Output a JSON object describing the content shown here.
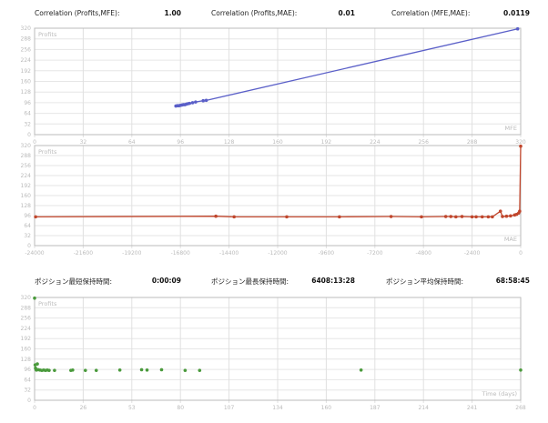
{
  "header1": [
    {
      "label": "Correlation (Profits,MFE):",
      "value": "1.00"
    },
    {
      "label": "Correlation (Profits,MAE):",
      "value": "0.01"
    },
    {
      "label": "Correlation (MFE,MAE):",
      "value": "0.0119"
    }
  ],
  "header2": [
    {
      "label": "ポジション最短保持時間:",
      "value": "0:00:09"
    },
    {
      "label": "ポジション最長保持時間:",
      "value": "6408:13:28"
    },
    {
      "label": "ポジション平均保持時間:",
      "value": "68:58:45"
    }
  ],
  "chart_data": [
    {
      "type": "scatter",
      "ylabel": "Profits",
      "xlabel": "MFE",
      "color": "#5a5fc8",
      "line": true,
      "xlim": [
        0,
        320
      ],
      "ylim": [
        0,
        320
      ],
      "xticks": [
        "0",
        "32",
        "64",
        "96",
        "128",
        "160",
        "192",
        "224",
        "256",
        "288",
        "320"
      ],
      "yticks": [
        "0",
        "32",
        "64",
        "96",
        "128",
        "160",
        "192",
        "224",
        "256",
        "288",
        "320"
      ],
      "points": [
        [
          93,
          86
        ],
        [
          94,
          87
        ],
        [
          95,
          87
        ],
        [
          96,
          88
        ],
        [
          97,
          89
        ],
        [
          98,
          90
        ],
        [
          99,
          90
        ],
        [
          100,
          92
        ],
        [
          101,
          93
        ],
        [
          102,
          94
        ],
        [
          104,
          96
        ],
        [
          106,
          98
        ],
        [
          111,
          102
        ],
        [
          113,
          103
        ],
        [
          318,
          318
        ]
      ]
    },
    {
      "type": "scatter",
      "ylabel": "Profits",
      "xlabel": "MAE",
      "color": "#c0462c",
      "line": true,
      "xlim": [
        -24000,
        0
      ],
      "ylim": [
        0,
        320
      ],
      "xticks": [
        "-24000",
        "-21600",
        "-19200",
        "-16800",
        "-14400",
        "-12000",
        "-9600",
        "-7200",
        "-4800",
        "-2400",
        "0"
      ],
      "yticks": [
        "0",
        "32",
        "64",
        "96",
        "128",
        "160",
        "192",
        "224",
        "256",
        "288",
        "320"
      ],
      "points": [
        [
          -23950,
          92
        ],
        [
          -15050,
          94
        ],
        [
          -14150,
          92
        ],
        [
          -11550,
          92
        ],
        [
          -8950,
          92
        ],
        [
          -6400,
          93
        ],
        [
          -4900,
          92
        ],
        [
          -3700,
          93
        ],
        [
          -3450,
          93
        ],
        [
          -3200,
          92
        ],
        [
          -2900,
          93
        ],
        [
          -2400,
          92
        ],
        [
          -2200,
          92
        ],
        [
          -1900,
          92
        ],
        [
          -1600,
          92
        ],
        [
          -1400,
          92
        ],
        [
          -1000,
          110
        ],
        [
          -900,
          93
        ],
        [
          -700,
          94
        ],
        [
          -500,
          95
        ],
        [
          -300,
          98
        ],
        [
          -200,
          100
        ],
        [
          -100,
          104
        ],
        [
          -50,
          110
        ],
        [
          0,
          318
        ]
      ]
    },
    {
      "type": "scatter",
      "ylabel": "Profits",
      "xlabel": "Time (days)",
      "color": "#4a9a3c",
      "line": false,
      "xlim": [
        0,
        268
      ],
      "ylim": [
        0,
        320
      ],
      "xticks": [
        "0",
        "26",
        "53",
        "80",
        "107",
        "134",
        "160",
        "187",
        "214",
        "241",
        "268"
      ],
      "yticks": [
        "0",
        "32",
        "64",
        "96",
        "128",
        "160",
        "192",
        "224",
        "256",
        "288",
        "320"
      ],
      "points": [
        [
          0,
          318
        ],
        [
          0.3,
          110
        ],
        [
          0.5,
          100
        ],
        [
          0.8,
          96
        ],
        [
          1,
          94
        ],
        [
          1.5,
          113
        ],
        [
          2,
          95
        ],
        [
          3,
          94
        ],
        [
          4,
          93
        ],
        [
          5,
          94
        ],
        [
          6,
          93
        ],
        [
          7,
          94
        ],
        [
          8,
          93
        ],
        [
          11,
          93
        ],
        [
          20,
          93
        ],
        [
          21,
          94
        ],
        [
          28,
          93
        ],
        [
          34,
          93
        ],
        [
          47,
          94
        ],
        [
          59,
          95
        ],
        [
          62,
          94
        ],
        [
          70,
          95
        ],
        [
          83,
          93
        ],
        [
          91,
          93
        ],
        [
          180,
          94
        ],
        [
          268,
          94
        ]
      ]
    }
  ]
}
